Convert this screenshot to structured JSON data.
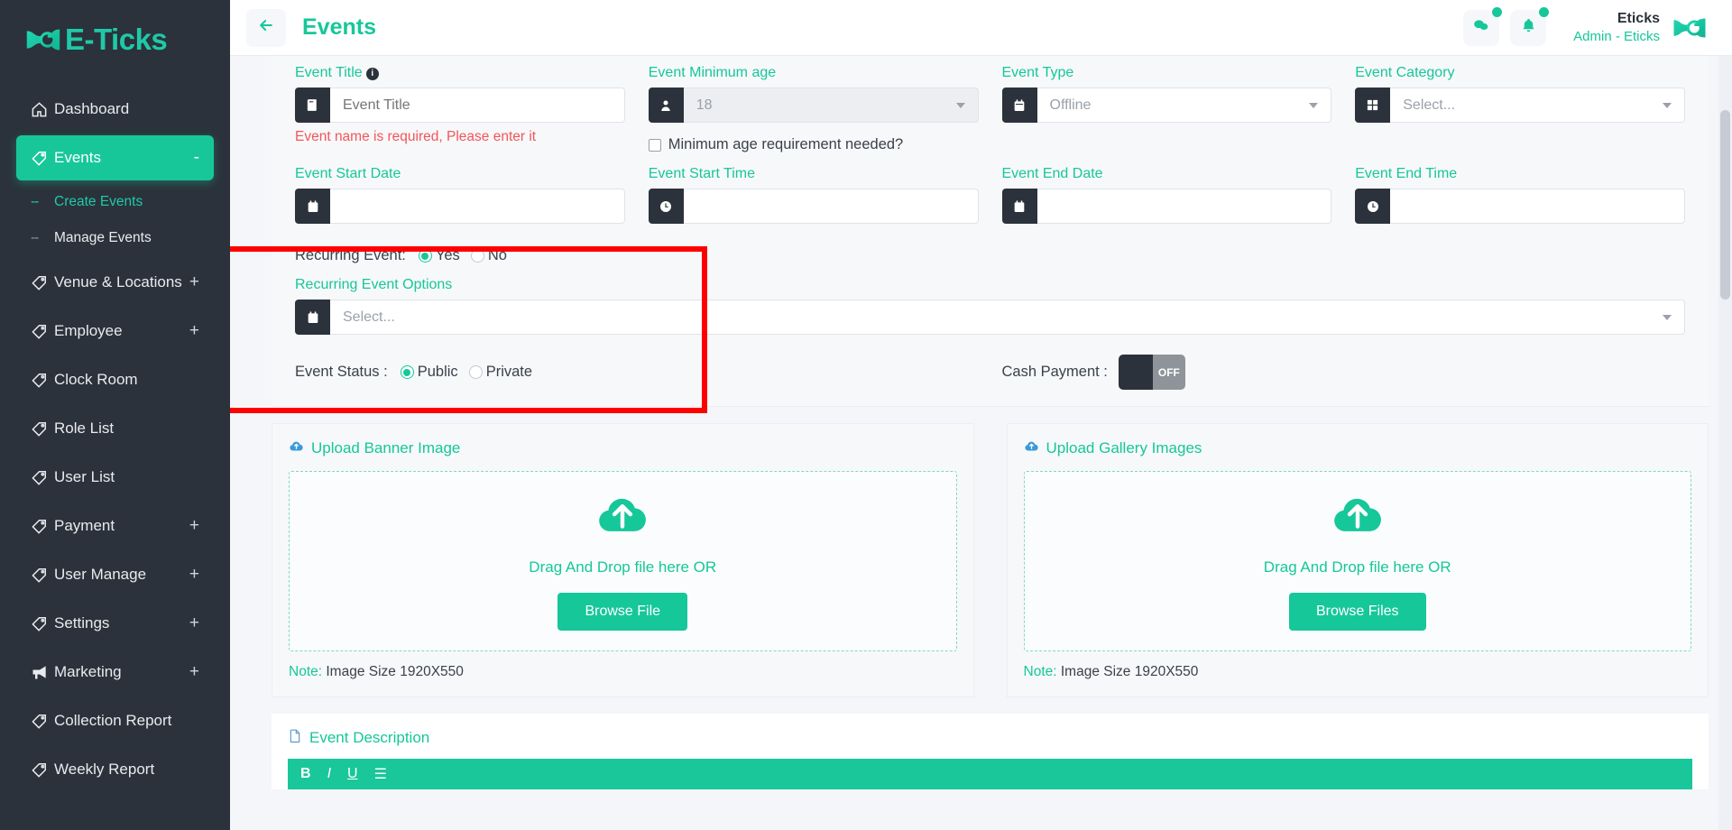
{
  "brand": {
    "name": "E-Ticks",
    "logo_icon": "eticks-logo-icon"
  },
  "sidebar": {
    "items": [
      {
        "label": "Dashboard",
        "icon": "home-icon",
        "expand": "",
        "active": false,
        "type": "item"
      },
      {
        "label": "Events",
        "icon": "tag-icon",
        "expand": "-",
        "active": true,
        "type": "item"
      },
      {
        "label": "Create Events",
        "icon": "dash-icon",
        "expand": "",
        "selected": true,
        "type": "sub"
      },
      {
        "label": "Manage Events",
        "icon": "dash-icon",
        "expand": "",
        "selected": false,
        "type": "sub"
      },
      {
        "label": "Venue & Locations",
        "icon": "tag-icon",
        "expand": "+",
        "active": false,
        "type": "item"
      },
      {
        "label": "Employee",
        "icon": "tag-icon",
        "expand": "+",
        "active": false,
        "type": "item"
      },
      {
        "label": "Clock Room",
        "icon": "tag-icon",
        "expand": "",
        "active": false,
        "type": "item"
      },
      {
        "label": "Role List",
        "icon": "tag-icon",
        "expand": "",
        "active": false,
        "type": "item"
      },
      {
        "label": "User List",
        "icon": "tag-icon",
        "expand": "",
        "active": false,
        "type": "item"
      },
      {
        "label": "Payment",
        "icon": "tag-icon",
        "expand": "+",
        "active": false,
        "type": "item"
      },
      {
        "label": "User Manage",
        "icon": "tag-icon",
        "expand": "+",
        "active": false,
        "type": "item"
      },
      {
        "label": "Settings",
        "icon": "tag-icon",
        "expand": "+",
        "active": false,
        "type": "item"
      },
      {
        "label": "Marketing",
        "icon": "megaphone-icon",
        "expand": "+",
        "active": false,
        "type": "item"
      },
      {
        "label": "Collection Report",
        "icon": "tag-icon",
        "expand": "",
        "active": false,
        "type": "item"
      },
      {
        "label": "Weekly Report",
        "icon": "tag-icon",
        "expand": "",
        "active": false,
        "type": "item"
      }
    ]
  },
  "topbar": {
    "back_icon": "arrow-left-icon",
    "title": "Events",
    "chat_icon": "chat-bubbles-icon",
    "bell_icon": "bell-icon",
    "user_name": "Eticks",
    "user_role": "Admin - Eticks",
    "avatar_icon": "eticks-avatar-icon"
  },
  "form": {
    "event_title": {
      "label": "Event Title",
      "info_icon": "info-icon",
      "addon_icon": "book-icon",
      "value": "",
      "placeholder": "Event Title",
      "error": "Event name is required, Please enter it"
    },
    "event_min_age": {
      "label": "Event Minimum age",
      "addon_icon": "user-icon",
      "value": "18",
      "checkbox_label": "Minimum age requirement needed?",
      "checkbox_checked": false
    },
    "event_type": {
      "label": "Event Type",
      "addon_icon": "calendar-icon",
      "value": "Offline"
    },
    "event_category": {
      "label": "Event Category",
      "addon_icon": "grid-icon",
      "value": "Select..."
    },
    "event_start_date": {
      "label": "Event Start Date",
      "addon_icon": "calendar-icon",
      "value": ""
    },
    "event_start_time": {
      "label": "Event Start Time",
      "addon_icon": "clock-icon",
      "value": ""
    },
    "event_end_date": {
      "label": "Event End Date",
      "addon_icon": "calendar-icon",
      "value": ""
    },
    "event_end_time": {
      "label": "Event End Time",
      "addon_icon": "clock-icon",
      "value": ""
    },
    "recurring": {
      "label": "Recurring Event:",
      "yes_label": "Yes",
      "no_label": "No",
      "selected": "Yes",
      "options_label": "Recurring Event Options",
      "options_addon_icon": "calendar-icon",
      "options_value": "Select..."
    },
    "event_status": {
      "label": "Event Status :",
      "public_label": "Public",
      "private_label": "Private",
      "selected": "Public"
    },
    "cash_payment": {
      "label": "Cash Payment :",
      "state": "OFF"
    }
  },
  "uploads": [
    {
      "title": "Upload Banner Image",
      "title_icon": "cloud-upload-icon",
      "drop_icon": "cloud-upload-icon",
      "drop_text": "Drag And Drop file here OR",
      "button": "Browse File",
      "note_label": "Note:",
      "note_value": "Image Size 1920X550"
    },
    {
      "title": "Upload Gallery Images",
      "title_icon": "cloud-upload-icon",
      "drop_icon": "cloud-upload-icon",
      "drop_text": "Drag And Drop file here OR",
      "button": "Browse Files",
      "note_label": "Note:",
      "note_value": "Image Size 1920X550"
    }
  ],
  "description": {
    "title": "Event Description",
    "title_icon": "document-icon",
    "toolbar": [
      "B",
      "I",
      "U",
      "☰"
    ]
  },
  "colors": {
    "accent": "#16c79a",
    "sidebar_bg": "#2b323b",
    "error": "#f4555a",
    "highlight": "#ff0000"
  }
}
